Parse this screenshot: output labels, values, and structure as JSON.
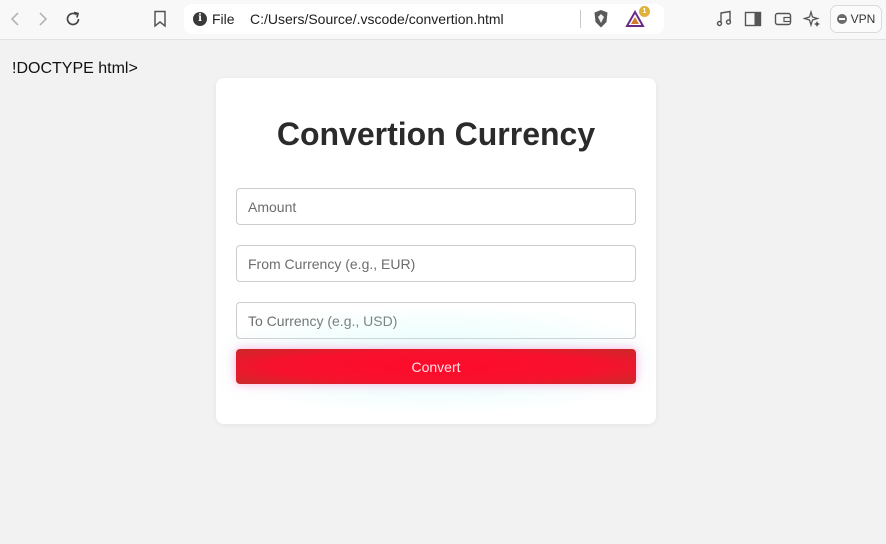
{
  "browser": {
    "url_scheme_label": "File",
    "url": "C:/Users/Source/.vscode/convertion.html",
    "rewards_badge_count": "1",
    "vpn_label": "VPN"
  },
  "page": {
    "stray_text": "!DOCTYPE html>",
    "title": "Convertion Currency",
    "amount_placeholder": "Amount",
    "from_placeholder": "From Currency (e.g., EUR)",
    "to_placeholder": "To Currency (e.g., USD)",
    "convert_label": "Convert"
  },
  "colors": {
    "button_red": "#ff0a2c",
    "page_background": "#f2f2f2",
    "card_background": "#ffffff"
  }
}
